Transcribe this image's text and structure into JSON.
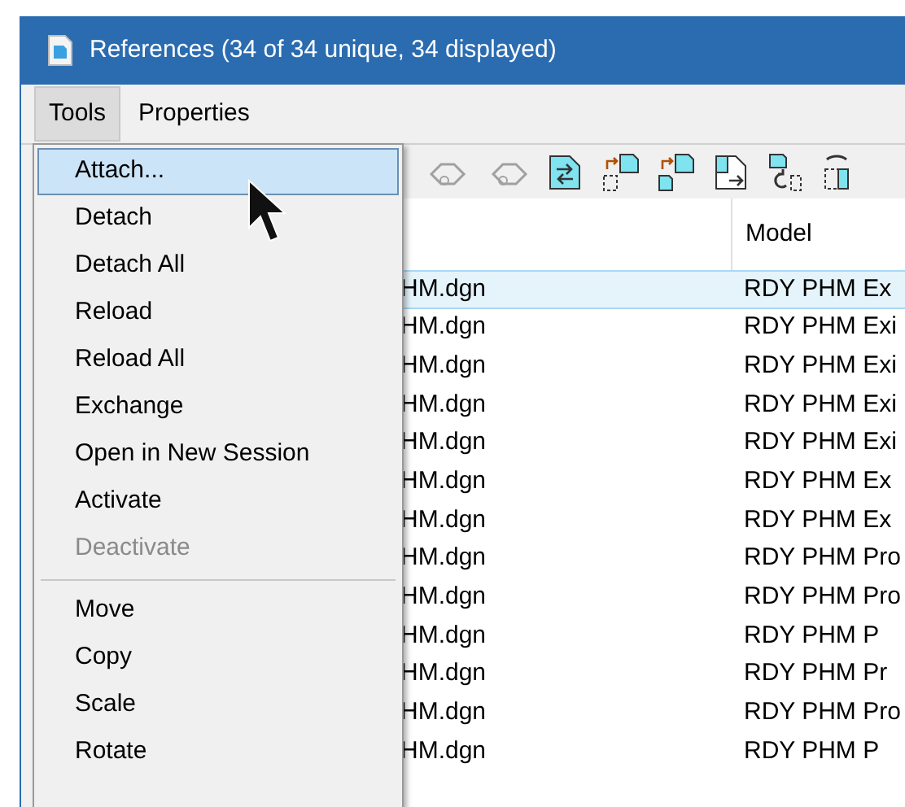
{
  "window": {
    "title": "References (34 of 34 unique, 34 displayed)"
  },
  "menubar": [
    {
      "label": "Tools",
      "selected": true
    },
    {
      "label": "Properties",
      "selected": false
    }
  ],
  "toolbar": [
    {
      "kind": "car-in",
      "disabled": true
    },
    {
      "kind": "car-out",
      "disabled": true
    },
    {
      "kind": "swap",
      "disabled": false
    },
    {
      "kind": "move",
      "disabled": false
    },
    {
      "kind": "copy",
      "disabled": false
    },
    {
      "kind": "scale",
      "disabled": false
    },
    {
      "kind": "rotate",
      "disabled": false
    },
    {
      "kind": "mirror",
      "disabled": false
    }
  ],
  "table": {
    "columns": [
      "Model"
    ],
    "rows": [
      {
        "file": "HM.dgn",
        "model": "RDY PHM Ex",
        "selected": true
      },
      {
        "file": "HM.dgn",
        "model": "RDY PHM Exi",
        "selected": false
      },
      {
        "file": "HM.dgn",
        "model": "RDY PHM Exi",
        "selected": false
      },
      {
        "file": "HM.dgn",
        "model": "RDY PHM Exi",
        "selected": false
      },
      {
        "file": "HM.dgn",
        "model": "RDY PHM Exi",
        "selected": false
      },
      {
        "file": "HM.dgn",
        "model": "RDY PHM Ex",
        "selected": false
      },
      {
        "file": "HM.dgn",
        "model": "RDY PHM Ex",
        "selected": false
      },
      {
        "file": "HM.dgn",
        "model": "RDY PHM Pro",
        "selected": false
      },
      {
        "file": "HM.dgn",
        "model": "RDY PHM Pro",
        "selected": false
      },
      {
        "file": "HM.dgn",
        "model": "RDY PHM P",
        "selected": false
      },
      {
        "file": "HM.dgn",
        "model": "RDY PHM Pr",
        "selected": false
      },
      {
        "file": "HM.dgn",
        "model": "RDY PHM Pro",
        "selected": false
      },
      {
        "file": "HM.dgn",
        "model": "RDY PHM P",
        "selected": false
      }
    ]
  },
  "menu": {
    "items": [
      {
        "kind": "item",
        "label": "Attach...",
        "selected": true,
        "disabled": false
      },
      {
        "kind": "item",
        "label": "Detach",
        "selected": false,
        "disabled": false
      },
      {
        "kind": "item",
        "label": "Detach All",
        "selected": false,
        "disabled": false
      },
      {
        "kind": "item",
        "label": "Reload",
        "selected": false,
        "disabled": false
      },
      {
        "kind": "item",
        "label": "Reload All",
        "selected": false,
        "disabled": false
      },
      {
        "kind": "item",
        "label": "Exchange",
        "selected": false,
        "disabled": false
      },
      {
        "kind": "item",
        "label": "Open in New Session",
        "selected": false,
        "disabled": false
      },
      {
        "kind": "item",
        "label": "Activate",
        "selected": false,
        "disabled": false
      },
      {
        "kind": "item",
        "label": "Deactivate",
        "selected": false,
        "disabled": true
      },
      {
        "kind": "separator"
      },
      {
        "kind": "item",
        "label": "Move",
        "selected": false,
        "disabled": false
      },
      {
        "kind": "item",
        "label": "Copy",
        "selected": false,
        "disabled": false
      },
      {
        "kind": "item",
        "label": "Scale",
        "selected": false,
        "disabled": false
      },
      {
        "kind": "item",
        "label": "Rotate",
        "selected": false,
        "disabled": false
      }
    ]
  }
}
